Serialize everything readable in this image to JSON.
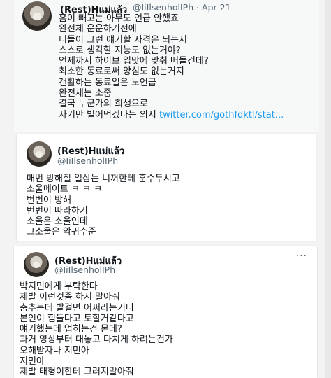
{
  "tweet1": {
    "name": "(Rest)Hแม่แล้ว",
    "handle_date": "@IiIlsenholIPh · Apr 21",
    "lines": [
      "홈이 빼고는 아무도 언급 안했죠",
      "완전체 운운하기전에",
      "니들이 그런 얘기할 자격은 되는지",
      "스스로 생각할 지능도 없는거야?",
      "언제까지 하이브 입맛에 맞춰 떠들건데?",
      "최소한 동료로써 양심도 없는거지",
      "갠활하는 동료일은 노언급",
      "완전체는 소중",
      "결국 누군가의 희생으로",
      "자기만 빌어먹겠다는 의지"
    ],
    "link": "twitter.com/gothfdktl/stat..."
  },
  "tweet2": {
    "name": "(Rest)Hแม่แล้ว",
    "handle": "@IiIlsenholIPh",
    "lines": [
      "매번 방해질 일삼는 니꺼한테 훈수두시고",
      "소울메이트 ㅋ ㅋ ㅋ",
      "번번이 방해",
      "번번이 따라하기",
      "소울은 소울인데",
      "그소울은 악귀수준"
    ]
  },
  "tweet3": {
    "name": "(Rest)Hแม่แล้ว",
    "handle": "@IiIlsenholIPh",
    "more": "···",
    "lines": [
      "박지민에게 부탁한다",
      "제발 이런것좀 하지 말아줘",
      "춤추는데 발걸면 어쩌라는거니",
      "본인이 힘들다고 토할거같다고",
      "얘기했는데 업히는건 몬데?",
      "과거 영상부터 대놓고 다치게 하려는건가",
      "오해받자나 지민아",
      "지민아",
      "제발 태형이한테 그러지말아줘"
    ]
  }
}
